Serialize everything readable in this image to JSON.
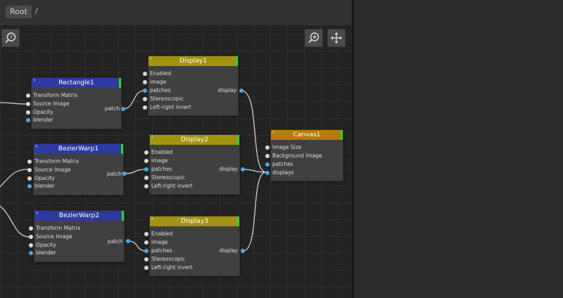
{
  "breadcrumb": {
    "root": "Root",
    "separator": "/"
  },
  "toolbar": {
    "help_icon": "help-search-icon",
    "zoom_icon": "zoom-in-icon",
    "pan_icon": "move-arrows-icon"
  },
  "colors": {
    "header_blue": "#2c3aa4",
    "header_yellow": "#a29410",
    "header_orange": "#b97a0c",
    "status_green": "#22dd22",
    "port_blue": "#47a8e8",
    "port_white": "#d8d8d8"
  },
  "nodes": {
    "rectangle1": {
      "index": "3",
      "title": "Rectangle1",
      "inputs": [
        "Transform Matrix",
        "Source Image",
        "Opacity",
        "blender"
      ],
      "output": "patch"
    },
    "bezierwarp1": {
      "index": "4",
      "title": "BezierWarp1",
      "inputs": [
        "Transform Matrix",
        "Source Image",
        "Opacity",
        "blender"
      ],
      "output": "patch"
    },
    "bezierwarp2": {
      "index": "5",
      "title": "BezierWarp2",
      "inputs": [
        "Transform Matrix",
        "Source Image",
        "Opacity",
        "blender"
      ],
      "output": "patch"
    },
    "display1": {
      "index": "6",
      "title": "Display1",
      "inputs": [
        "Enabled",
        "image",
        "patches",
        "Stereoscopic",
        "Left-right invert"
      ],
      "output": "display"
    },
    "display2": {
      "index": "7",
      "title": "Display2",
      "inputs": [
        "Enabled",
        "image",
        "patches",
        "Stereoscopic",
        "Left-right invert"
      ],
      "output": "display"
    },
    "display3": {
      "index": "8",
      "title": "Display3",
      "inputs": [
        "Enabled",
        "image",
        "patches",
        "Stereoscopic",
        "Left-right invert"
      ],
      "output": "display"
    },
    "canvas1": {
      "index": "9",
      "title": "Canvas1",
      "inputs": [
        "Image Size",
        "Background Image",
        "patches",
        "displays"
      ]
    }
  }
}
